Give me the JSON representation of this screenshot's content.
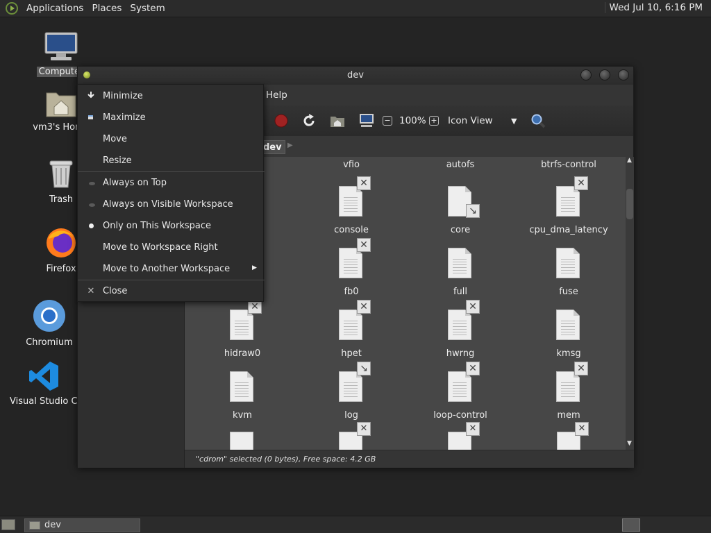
{
  "top_panel": {
    "applications": "Applications",
    "places": "Places",
    "system": "System",
    "clock": "Wed Jul 10,  6:16 PM"
  },
  "desktop": {
    "icons": [
      {
        "label": "Computer",
        "icon": "computer-icon"
      },
      {
        "label": "vm3's Home",
        "icon": "home-folder-icon"
      },
      {
        "label": "Trash",
        "icon": "trash-icon"
      },
      {
        "label": "Firefox",
        "icon": "firefox-icon"
      },
      {
        "label": "Chromium",
        "icon": "chromium-icon"
      },
      {
        "label": "Visual Studio Code",
        "icon": "vscode-icon"
      }
    ]
  },
  "window": {
    "title": "dev",
    "menubar": {
      "help": "Help"
    },
    "toolbar": {
      "zoom": "100%",
      "view_mode": "Icon View"
    },
    "location": {
      "current": "dev"
    },
    "files_row0": [
      "vfio",
      "autofs",
      "btrfs-control"
    ],
    "files": [
      {
        "name": "console",
        "emblem": "x"
      },
      {
        "name": "core",
        "emblem": "arrow",
        "blank": true
      },
      {
        "name": "cpu_dma_latency",
        "emblem": "x"
      },
      {
        "name": "fb0",
        "emblem": "x"
      },
      {
        "name": "full",
        "emblem": ""
      },
      {
        "name": "fuse",
        "emblem": ""
      },
      {
        "name": "hidraw0",
        "emblem": "x"
      },
      {
        "name": "hpet",
        "emblem": "x"
      },
      {
        "name": "hwrng",
        "emblem": "x"
      },
      {
        "name": "kmsg",
        "emblem": ""
      },
      {
        "name": "kvm",
        "emblem": ""
      },
      {
        "name": "log",
        "emblem": "arrow"
      },
      {
        "name": "loop-control",
        "emblem": "x"
      },
      {
        "name": "mem",
        "emblem": "x"
      }
    ],
    "statusbar": "\"cdrom\" selected (0 bytes), Free space: 4.2 GB"
  },
  "window_menu": {
    "items": [
      {
        "label": "Minimize",
        "icon": "minimize-icon"
      },
      {
        "label": "Maximize",
        "icon": "maximize-icon"
      },
      {
        "label": "Move",
        "icon": ""
      },
      {
        "label": "Resize",
        "icon": ""
      },
      {
        "label": "Always on Top",
        "icon": "radio-off"
      },
      {
        "label": "Always on Visible Workspace",
        "icon": "radio-off"
      },
      {
        "label": "Only on This Workspace",
        "icon": "radio-on"
      },
      {
        "label": "Move to Workspace Right",
        "icon": ""
      },
      {
        "label": "Move to Another Workspace",
        "icon": "submenu"
      },
      {
        "label": "Close",
        "icon": "close-icon"
      }
    ]
  },
  "bottom_panel": {
    "task_label": "dev"
  }
}
